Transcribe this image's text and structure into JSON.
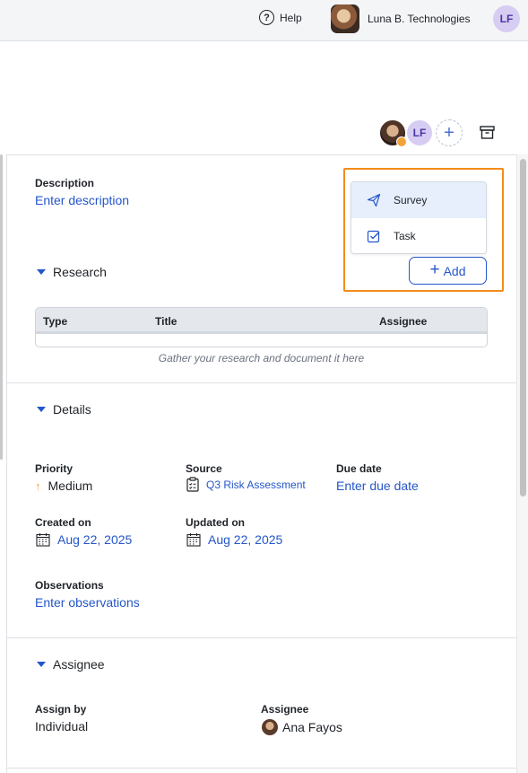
{
  "header": {
    "help_label": "Help",
    "org_name": "Luna B. Technologies",
    "user_initials": "LF"
  },
  "toolbar": {
    "collaborator_initials": "LF",
    "add_collaborator_symbol": "+"
  },
  "description": {
    "label": "Description",
    "placeholder_link": "Enter description"
  },
  "add_menu": {
    "items": [
      {
        "label": "Survey",
        "icon": "paper-plane-icon",
        "active": true
      },
      {
        "label": "Task",
        "icon": "checkbox-icon",
        "active": false
      }
    ],
    "add_button_label": "Add"
  },
  "research": {
    "title": "Research",
    "columns": [
      "Type",
      "Title",
      "Assignee"
    ],
    "empty_text": "Gather your research and document it here"
  },
  "details": {
    "title": "Details",
    "priority_label": "Priority",
    "priority_value": "Medium",
    "source_label": "Source",
    "source_value": "Q3 Risk Assessment",
    "due_label": "Due date",
    "due_value": "Enter due date",
    "created_label": "Created on",
    "created_value": "Aug 22, 2025",
    "updated_label": "Updated on",
    "updated_value": "Aug 22, 2025",
    "observations_label": "Observations",
    "observations_value": "Enter observations"
  },
  "assignee": {
    "title": "Assignee",
    "assign_by_label": "Assign by",
    "assign_by_value": "Individual",
    "assignee_label": "Assignee",
    "assignee_value": "Ana Fayos"
  },
  "colors": {
    "accent": "#2456c9",
    "highlight": "#f28c1b",
    "avatar_bg": "#d7cdf3"
  }
}
